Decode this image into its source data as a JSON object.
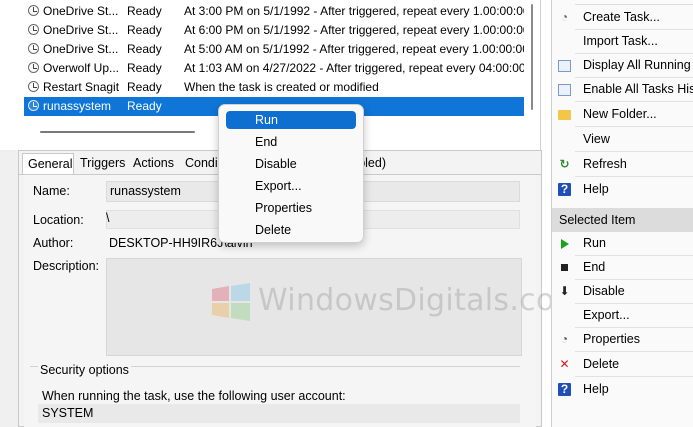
{
  "tasks": [
    {
      "name": "OneDrive St...",
      "status": "Ready",
      "trigger": "At 3:00 PM on 5/1/1992 - After triggered, repeat every 1.00:00:00"
    },
    {
      "name": "OneDrive St...",
      "status": "Ready",
      "trigger": "At 6:00 PM on 5/1/1992 - After triggered, repeat every 1.00:00:00"
    },
    {
      "name": "OneDrive St...",
      "status": "Ready",
      "trigger": "At 5:00 AM on 5/1/1992 - After triggered, repeat every 1.00:00:00"
    },
    {
      "name": "Overwolf Up...",
      "status": "Ready",
      "trigger": "At 1:03 AM on 4/27/2022 - After triggered, repeat every 04:00:00 i"
    },
    {
      "name": "Restart Snagit",
      "status": "Ready",
      "trigger": "When the task is created or modified"
    },
    {
      "name": "runassystem",
      "status": "Ready",
      "trigger": ""
    }
  ],
  "tabs": {
    "general": "General",
    "triggers": "Triggers",
    "actions": "Actions",
    "conditions": "Condi",
    "history": "sabled)"
  },
  "general": {
    "name_label": "Name:",
    "name_value": "runassystem",
    "location_label": "Location:",
    "location_value": "\\",
    "author_label": "Author:",
    "author_value": "DESKTOP-HH9IR6J\\alvin",
    "description_label": "Description:",
    "security_title": "Security options",
    "security_text": "When running the task, use the following user account:",
    "security_account": "SYSTEM"
  },
  "context_menu": {
    "items": [
      "Run",
      "End",
      "Disable",
      "Export...",
      "Properties",
      "Delete"
    ],
    "highlighted": "Run"
  },
  "actions_pane": {
    "top_items": [
      {
        "label": "Create Task...",
        "icon": "create-task-icon"
      },
      {
        "label": "Import Task...",
        "icon": "none"
      },
      {
        "label": "Display All Running T",
        "icon": "display-running-icon"
      },
      {
        "label": "Enable All Tasks Histo",
        "icon": "history-icon"
      },
      {
        "label": "New Folder...",
        "icon": "folder-icon"
      },
      {
        "label": "View",
        "icon": "none"
      },
      {
        "label": "Refresh",
        "icon": "refresh-icon"
      },
      {
        "label": "Help",
        "icon": "help-icon"
      }
    ],
    "section_header": "Selected Item",
    "selected_items": [
      {
        "label": "Run",
        "icon": "run-icon"
      },
      {
        "label": "End",
        "icon": "end-icon"
      },
      {
        "label": "Disable",
        "icon": "disable-icon"
      },
      {
        "label": "Export...",
        "icon": "none"
      },
      {
        "label": "Properties",
        "icon": "properties-icon"
      },
      {
        "label": "Delete",
        "icon": "delete-icon"
      },
      {
        "label": "Help",
        "icon": "help-icon"
      }
    ]
  },
  "watermark": {
    "text": "WindowsDigitals.com"
  },
  "colors": {
    "selection": "#0f75d6",
    "menu_highlight": "#0f6fd0",
    "run_green": "#1aa31a",
    "delete_red": "#d11a1a",
    "help_blue": "#1f4fb4"
  }
}
